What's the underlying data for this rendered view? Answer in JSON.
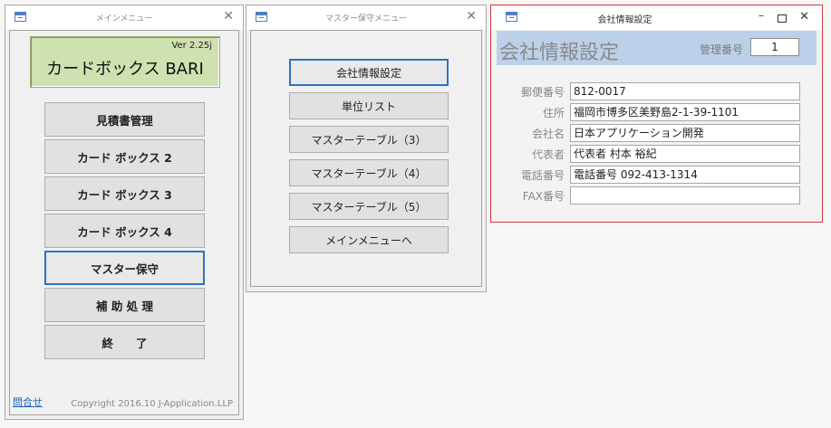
{
  "main_menu": {
    "title": "メインメニュー",
    "version": "Ver 2.25j",
    "app_name": "カードボックス BARI",
    "buttons": [
      "見積書管理",
      "カード ボックス 2",
      "カード ボックス 3",
      "カード ボックス 4",
      "マスター保守",
      "補 助 処 理",
      "終　　了"
    ],
    "selected_button": "マスター保守",
    "contact_link": "問合せ",
    "copyright": "Copyright 2016.10 J-Application.LLP"
  },
  "master_menu": {
    "title": "マスター保守メニュー",
    "buttons": [
      "会社情報設定",
      "単位リスト",
      "マスターテーブル（3）",
      "マスターテーブル（4）",
      "マスターテーブル（5）",
      "メインメニューへ"
    ],
    "selected_button": "会社情報設定"
  },
  "company_form": {
    "window_title": "会社情報設定",
    "header_title": "会社情報設定",
    "id_label": "管理番号",
    "id_value": "1",
    "fields": [
      {
        "label": "郵便番号",
        "value": "812-0017"
      },
      {
        "label": "住所",
        "value": "福岡市博多区美野島2-1-39-1101"
      },
      {
        "label": "会社名",
        "value": "日本アプリケーション開発"
      },
      {
        "label": "代表者",
        "value": "代表者 村本 裕紀"
      },
      {
        "label": "電話番号",
        "value": "電話番号 092-413-1314"
      },
      {
        "label": "FAX番号",
        "value": ""
      }
    ],
    "controls": {
      "minimize": "–",
      "close": "✕"
    }
  },
  "window_close_glyph": "✕",
  "colors": {
    "accent_border": "#2b72c2",
    "version_box_bg": "#cfe0b1",
    "header_bg": "#bdd0ea",
    "active_window_border": "#d0393e",
    "link": "#1a5fb4"
  }
}
